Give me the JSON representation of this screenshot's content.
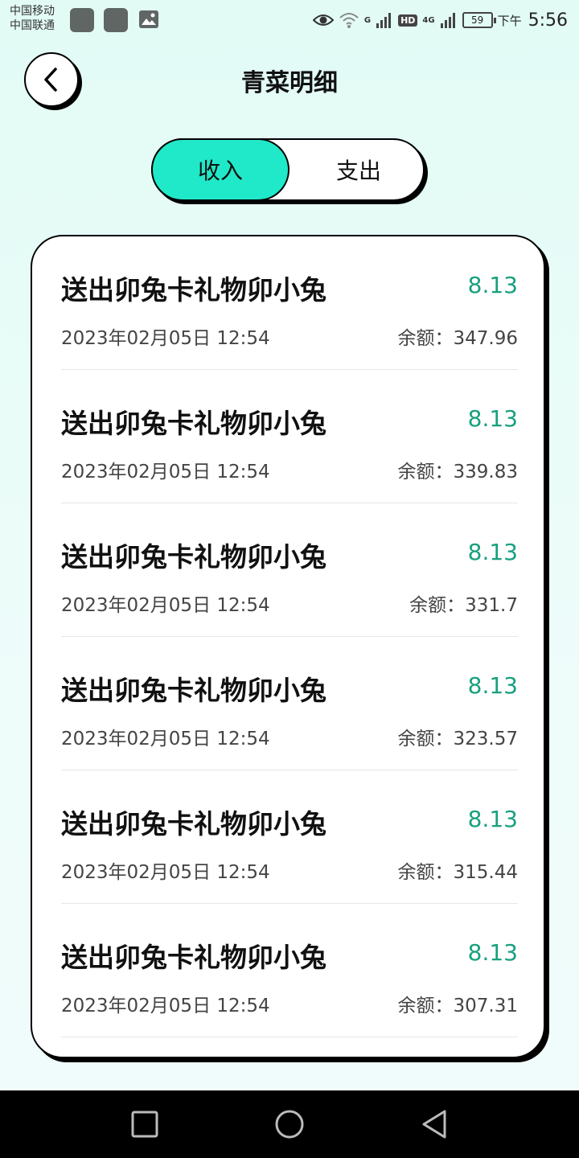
{
  "status_bar": {
    "carrier1": "中国移动",
    "carrier2": "中国联通",
    "signal1": "G",
    "hd": "HD",
    "signal2": "4G",
    "battery": "59",
    "ampm": "下午",
    "time": "5:56"
  },
  "header": {
    "title": "青菜明细",
    "back_icon": "chevron-left-icon"
  },
  "tabs": [
    {
      "label": "收入",
      "active": true
    },
    {
      "label": "支出",
      "active": false
    }
  ],
  "colors": {
    "accent": "#1fe9c8",
    "amount": "#18a07e",
    "background": "#e6fbf6"
  },
  "records": [
    {
      "title": "送出卯兔卡礼物卯小兔",
      "amount": "8.13",
      "date": "2023年02月05日 12:54",
      "balance": "余额：347.96"
    },
    {
      "title": "送出卯兔卡礼物卯小兔",
      "amount": "8.13",
      "date": "2023年02月05日 12:54",
      "balance": "余额：339.83"
    },
    {
      "title": "送出卯兔卡礼物卯小兔",
      "amount": "8.13",
      "date": "2023年02月05日 12:54",
      "balance": "余额：331.7"
    },
    {
      "title": "送出卯兔卡礼物卯小兔",
      "amount": "8.13",
      "date": "2023年02月05日 12:54",
      "balance": "余额：323.57"
    },
    {
      "title": "送出卯兔卡礼物卯小兔",
      "amount": "8.13",
      "date": "2023年02月05日 12:54",
      "balance": "余额：315.44"
    },
    {
      "title": "送出卯兔卡礼物卯小兔",
      "amount": "8.13",
      "date": "2023年02月05日 12:54",
      "balance": "余额：307.31"
    }
  ],
  "nav_bar": {
    "recent": "square-icon",
    "home": "circle-icon",
    "back": "triangle-back-icon"
  }
}
